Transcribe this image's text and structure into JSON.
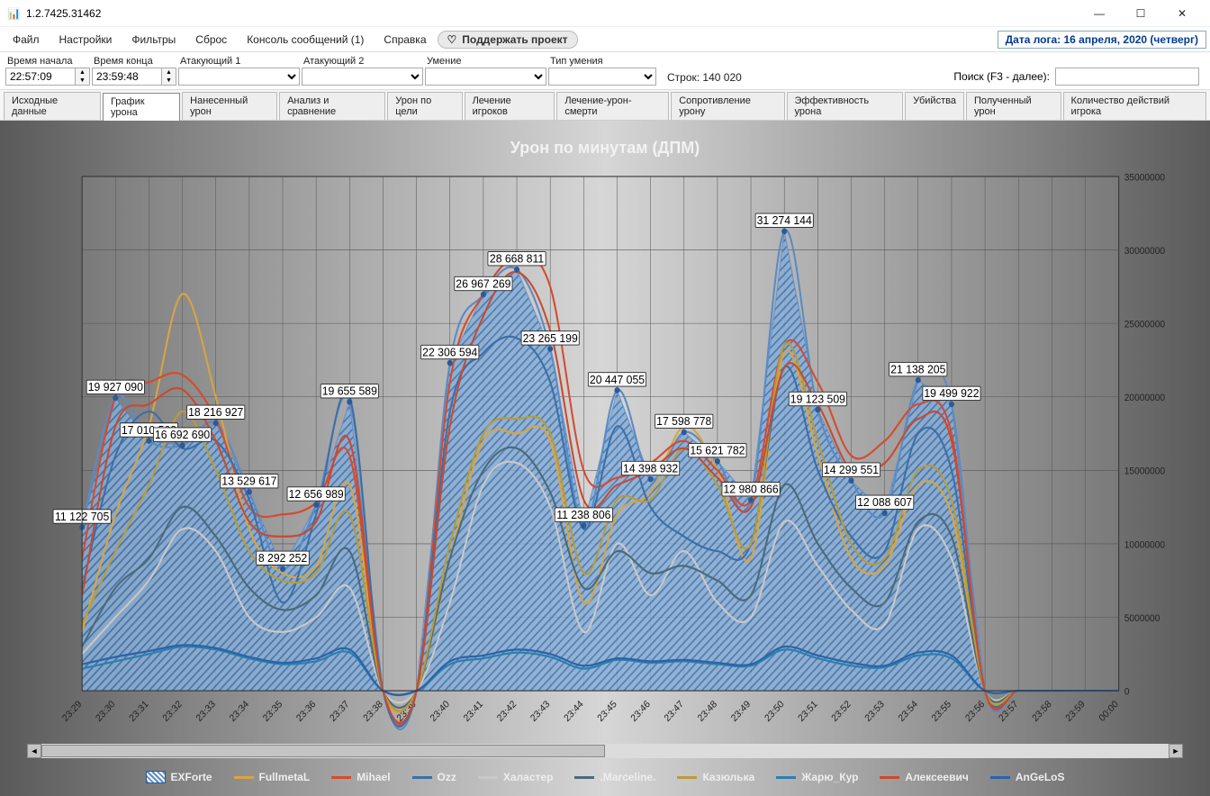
{
  "window": {
    "title": "1.2.7425.31462"
  },
  "menu": {
    "file": "Файл",
    "settings": "Настройки",
    "filters": "Фильтры",
    "reset": "Сброс",
    "console": "Консоль сообщений (1)",
    "help": "Справка",
    "support": "Поддержать проект",
    "logdate": "Дата лога: 16 апреля, 2020  (четверг)"
  },
  "filters": {
    "time_start_lbl": "Время начала",
    "time_end_lbl": "Время конца",
    "attacker1_lbl": "Атакующий 1",
    "attacker2_lbl": "Атакующий 2",
    "skill_lbl": "Умение",
    "skill_type_lbl": "Тип умения",
    "time_start": "22:57:09",
    "time_end": "23:59:48",
    "rows_label": "Строк: 140 020",
    "search_lbl": "Поиск (F3 - далее):"
  },
  "tabs": {
    "t0": "Исходные данные",
    "t1": "График урона",
    "t2": "Нанесенный урон",
    "t3": "Анализ и сравнение",
    "t4": "Урон по цели",
    "t5": "Лечение игроков",
    "t6": "Лечение-урон-смерти",
    "t7": "Сопротивление урону",
    "t8": "Эффективность урона",
    "t9": "Убийства",
    "t10": "Полученный урон",
    "t11": "Количество действий игрока"
  },
  "chart": {
    "title": "Урон по минутам (ДПМ)"
  },
  "legend": {
    "s0": "EXForte",
    "s1": "FullmetaL",
    "s2": "Mihael",
    "s3": "Ozz",
    "s4": "Халастер",
    "s5": ".Marceline.",
    "s6": "Казюлька",
    "s7": "Жарю_Кур",
    "s8": "Алексеевич",
    "s9": "AnGeLoS"
  },
  "chart_data": {
    "type": "line",
    "title": "Урон по минутам (ДПМ)",
    "xlabel": "",
    "ylabel": "",
    "ylim": [
      0,
      35000000
    ],
    "yticks": [
      0,
      5000000,
      10000000,
      15000000,
      20000000,
      25000000,
      30000000,
      35000000
    ],
    "categories": [
      "23:29",
      "23:30",
      "23:31",
      "23:32",
      "23:33",
      "23:34",
      "23:35",
      "23:36",
      "23:37",
      "23:38",
      "23:39",
      "23:40",
      "23:41",
      "23:42",
      "23:43",
      "23:44",
      "23:45",
      "23:46",
      "23:47",
      "23:48",
      "23:49",
      "23:50",
      "23:51",
      "23:52",
      "23:53",
      "23:54",
      "23:55",
      "23:56",
      "23:57",
      "23:58",
      "23:59",
      "00:00"
    ],
    "series": [
      {
        "name": "EXForte",
        "color": "#5a8bc4",
        "area": true,
        "values": [
          11122705,
          19927090,
          17010568,
          16692690,
          18216927,
          13529617,
          8292252,
          12656989,
          19655589,
          0,
          0,
          22306594,
          26967269,
          28668811,
          23265199,
          11238806,
          20447055,
          14398932,
          17598778,
          15621782,
          12980866,
          31274144,
          19123509,
          14299551,
          12088607,
          21138205,
          19499922,
          0,
          0,
          0,
          0,
          0
        ],
        "labels": [
          {
            "i": 0,
            "t": "11 122 705"
          },
          {
            "i": 1,
            "t": "19 927 090"
          },
          {
            "i": 2,
            "t": "17 010 568"
          },
          {
            "i": 3,
            "t": "16 692 690"
          },
          {
            "i": 4,
            "t": "18 216 927"
          },
          {
            "i": 5,
            "t": "13 529 617"
          },
          {
            "i": 6,
            "t": "8 292 252"
          },
          {
            "i": 7,
            "t": "12 656 989"
          },
          {
            "i": 8,
            "t": "19 655 589"
          },
          {
            "i": 11,
            "t": "22 306 594"
          },
          {
            "i": 12,
            "t": "26 967 269"
          },
          {
            "i": 13,
            "t": "28 668 811"
          },
          {
            "i": 14,
            "t": "23 265 199"
          },
          {
            "i": 15,
            "t": "11 238 806"
          },
          {
            "i": 16,
            "t": "20 447 055"
          },
          {
            "i": 17,
            "t": "14 398 932"
          },
          {
            "i": 18,
            "t": "17 598 778"
          },
          {
            "i": 19,
            "t": "15 621 782"
          },
          {
            "i": 20,
            "t": "12 980 866"
          },
          {
            "i": 21,
            "t": "31 274 144"
          },
          {
            "i": 22,
            "t": "19 123 509"
          },
          {
            "i": 23,
            "t": "14 299 551"
          },
          {
            "i": 24,
            "t": "12 088 607"
          },
          {
            "i": 25,
            "t": "21 138 205"
          },
          {
            "i": 26,
            "t": "19 499 922"
          }
        ]
      },
      {
        "name": "FullmetaL",
        "color": "#d9a441",
        "values": [
          4000000,
          12000000,
          18000000,
          27000000,
          20000000,
          11000000,
          8000000,
          8500000,
          14000000,
          0,
          0,
          9000000,
          17000000,
          17500000,
          17000000,
          6000000,
          12000000,
          13500000,
          18000000,
          15000000,
          9000000,
          23000000,
          16000000,
          9000000,
          8500000,
          14000000,
          12000000,
          0,
          0,
          0,
          0,
          0
        ]
      },
      {
        "name": "Mihael",
        "color": "#d54b2e",
        "values": [
          9000000,
          20000000,
          21000000,
          21500000,
          18500000,
          12500000,
          12000000,
          12800000,
          16000000,
          0,
          0,
          21000000,
          27000000,
          29500000,
          27500000,
          15000000,
          14500000,
          15500000,
          17000000,
          15000000,
          13000000,
          23500000,
          21000000,
          16000000,
          17000000,
          19500000,
          17500000,
          0,
          0,
          0,
          0,
          0
        ]
      },
      {
        "name": "Ozz",
        "color": "#3b6fa8",
        "values": [
          7000000,
          16000000,
          19000000,
          16500000,
          17000000,
          13000000,
          6000000,
          12000000,
          20000000,
          0,
          0,
          19000000,
          23000000,
          24000000,
          21000000,
          11000000,
          18000000,
          12500000,
          10500000,
          9500000,
          10000000,
          22000000,
          15000000,
          10500000,
          9500000,
          17500000,
          15000000,
          0,
          0,
          0,
          0,
          0
        ]
      },
      {
        "name": "Халастер",
        "color": "#c9c9c9",
        "values": [
          2500000,
          5000000,
          7500000,
          11000000,
          9500000,
          5000000,
          4000000,
          5000000,
          7000000,
          0,
          0,
          6000000,
          14000000,
          15500000,
          12500000,
          4000000,
          10000000,
          6500000,
          9500000,
          6000000,
          5000000,
          11500000,
          8500000,
          5500000,
          4500000,
          11000000,
          9000000,
          0,
          0,
          0,
          0,
          0
        ]
      },
      {
        "name": ".Marceline.",
        "color": "#4a6a7a",
        "values": [
          3000000,
          7000000,
          9000000,
          12500000,
          10500000,
          7000000,
          5500000,
          6500000,
          9500000,
          0,
          0,
          9000000,
          15000000,
          16500000,
          13500000,
          7000000,
          9500000,
          8000000,
          8500000,
          7500000,
          6500000,
          14000000,
          10000000,
          7000000,
          6000000,
          11500000,
          10500000,
          0,
          0,
          0,
          0,
          0
        ]
      },
      {
        "name": "Казюлька",
        "color": "#b89b3a",
        "values": [
          4500000,
          9500000,
          14000000,
          19000000,
          15000000,
          9500000,
          7500000,
          8000000,
          12000000,
          0,
          0,
          10000000,
          17500000,
          18500000,
          17500000,
          8000000,
          13000000,
          13000000,
          16500000,
          14000000,
          10000000,
          23500000,
          17000000,
          10000000,
          9000000,
          15000000,
          13000000,
          0,
          0,
          0,
          0,
          0
        ]
      },
      {
        "name": "Жарю_Кур",
        "color": "#2b7fb0",
        "values": [
          1500000,
          2000000,
          2500000,
          3000000,
          2800000,
          2200000,
          1800000,
          2000000,
          2600000,
          0,
          0,
          1800000,
          2200000,
          2600000,
          2300000,
          1500000,
          2100000,
          1900000,
          2000000,
          1800000,
          1700000,
          2800000,
          2200000,
          1700000,
          1600000,
          2400000,
          2200000,
          0,
          0,
          0,
          0,
          0
        ]
      },
      {
        "name": "Алексеевич",
        "color": "#c94a2e",
        "values": [
          6500000,
          18000000,
          19500000,
          20500000,
          17000000,
          11500000,
          10500000,
          11500000,
          17000000,
          0,
          0,
          18000000,
          25500000,
          28500000,
          24500000,
          13000000,
          14000000,
          15000000,
          16500000,
          14500000,
          12500000,
          22000000,
          19500000,
          15000000,
          15500000,
          18500000,
          17000000,
          0,
          0,
          0,
          0,
          0
        ]
      },
      {
        "name": "AnGeLoS",
        "color": "#2c63a6",
        "values": [
          1800000,
          2300000,
          2700000,
          3100000,
          2900000,
          2300000,
          1900000,
          2200000,
          2800000,
          0,
          0,
          2000000,
          2400000,
          2800000,
          2500000,
          1700000,
          2200000,
          2000000,
          2100000,
          1900000,
          1800000,
          3000000,
          2400000,
          1900000,
          1700000,
          2600000,
          2400000,
          0,
          0,
          0,
          0,
          0
        ]
      }
    ]
  }
}
